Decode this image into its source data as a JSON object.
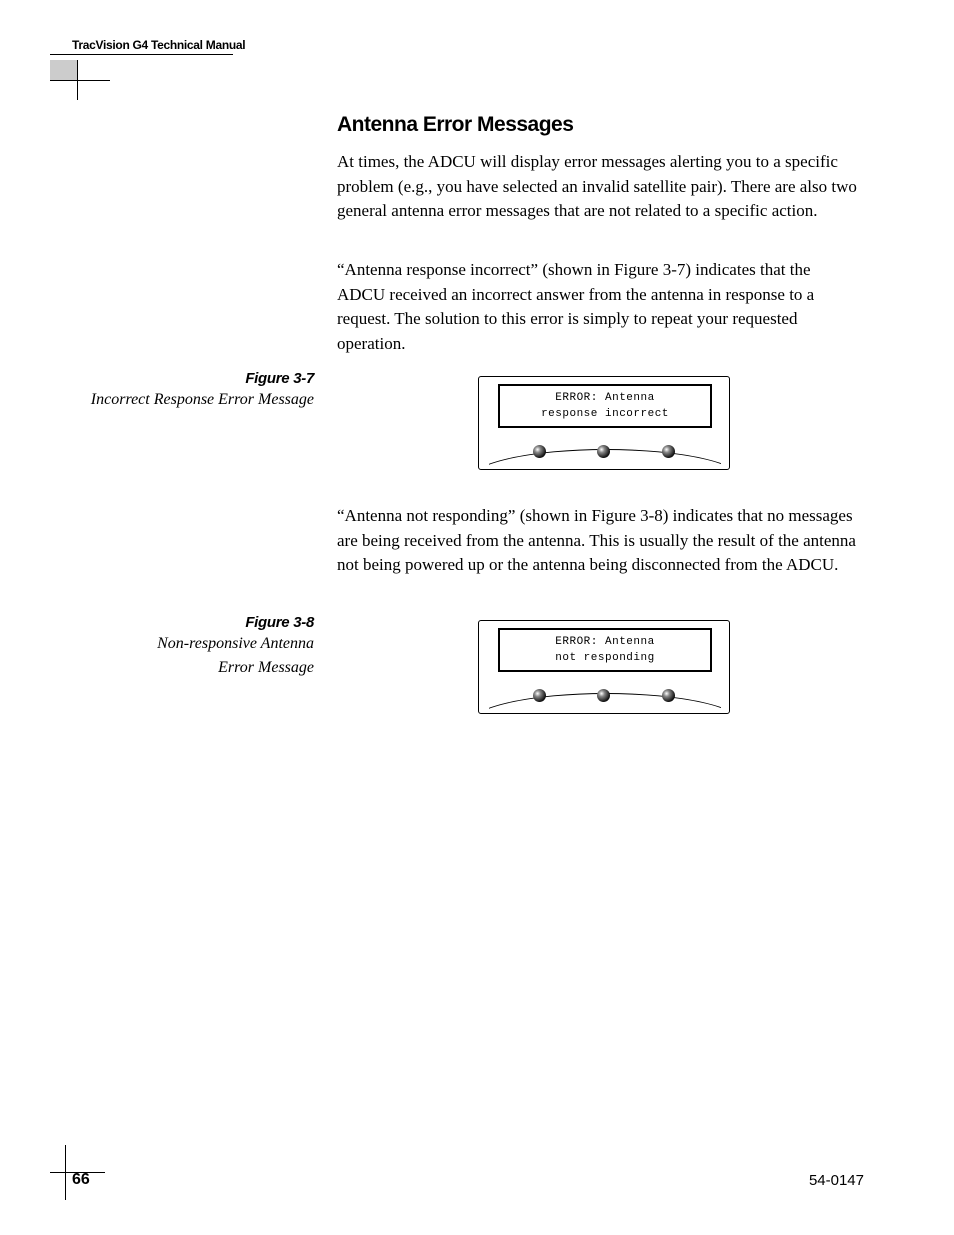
{
  "header": {
    "title": "TracVision G4 Technical Manual"
  },
  "section": {
    "heading": "Antenna Error Messages",
    "para1": "At times, the ADCU will display error messages alerting you to a specific problem (e.g., you have selected an invalid satellite pair). There are also two general antenna error messages that are not related to a specific action.",
    "para2": "“Antenna response incorrect” (shown in Figure 3-7) indicates that the ADCU received an incorrect answer from the antenna in response to a request. The solution to this error is simply to repeat your requested operation.",
    "para3": "“Antenna not responding” (shown in Figure 3-8) indicates that no messages are being received from the antenna. This is usually the result of the antenna not being powered up or the antenna being disconnected from the ADCU."
  },
  "figures": {
    "f1": {
      "number": "Figure 3-7",
      "caption": "Incorrect Response Error Message",
      "lcd_line1": "ERROR: Antenna",
      "lcd_line2": "response incorrect"
    },
    "f2": {
      "number": "Figure 3-8",
      "caption_line1": "Non-responsive Antenna",
      "caption_line2": "Error Message",
      "lcd_line1": "ERROR: Antenna",
      "lcd_line2": "not responding"
    }
  },
  "footer": {
    "page": "66",
    "doc": "54-0147"
  }
}
